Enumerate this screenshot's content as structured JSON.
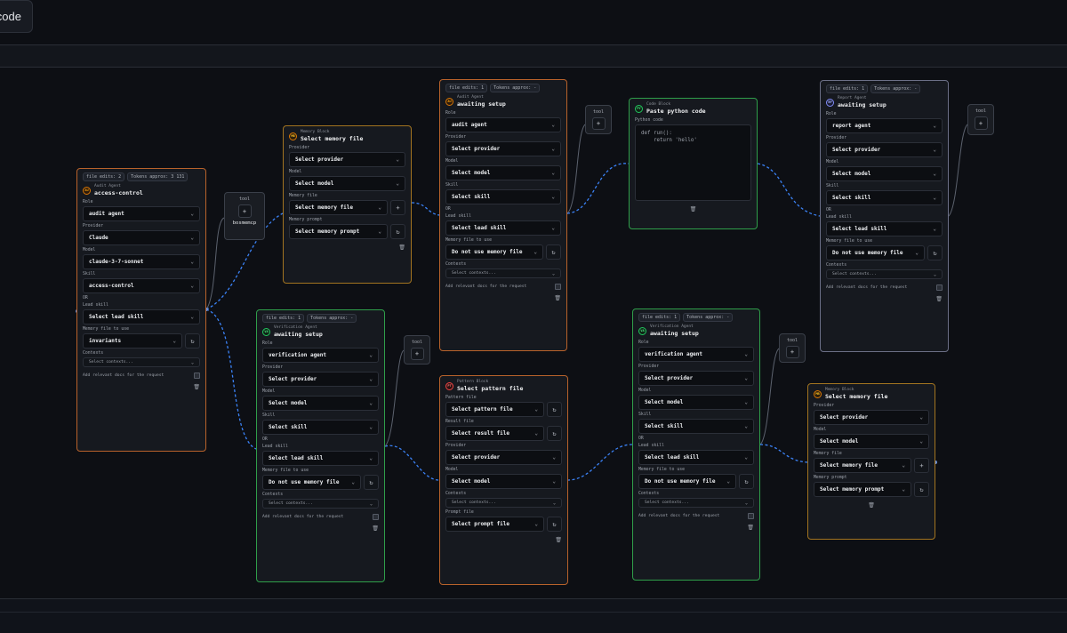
{
  "topbar": {
    "code_button_label": "code"
  },
  "tool_panels": [
    {
      "label": "tool",
      "add_icon": "plus-icon",
      "item": "bosmemcp"
    },
    {
      "label": "tool",
      "add_icon": "plus-icon"
    },
    {
      "label": "tool",
      "add_icon": "plus-icon"
    },
    {
      "label": "tool",
      "add_icon": "plus-icon"
    },
    {
      "label": "tool",
      "add_icon": "plus-icon"
    }
  ],
  "nodes": {
    "audit1": {
      "chips": [
        "file edits: 2",
        "Tokens approx: 3 131"
      ],
      "kind": "Audit Agent",
      "title": "access-control",
      "badge": "AU",
      "role_label": "Role",
      "role": "audit agent",
      "provider_label": "Provider",
      "provider": "Claude",
      "model_label": "Model",
      "model": "claude-3-7-sonnet",
      "skill_label": "Skill",
      "skill": "access-control",
      "or_label": "OR",
      "lead_label": "Lead skill",
      "lead": "Select lead skill",
      "memory_label": "Memory file to use",
      "memory": "invariants",
      "contexts_label": "Contexts",
      "contexts": "Select contexts...",
      "note": "Add relevant docs for the request"
    },
    "memory1": {
      "kind": "Memory Block",
      "title": "Select memory file",
      "badge": "MB",
      "provider_label": "Provider",
      "provider": "Select provider",
      "model_label": "Model",
      "model": "Select model",
      "file_label": "Memory file",
      "file": "Select memory file",
      "prompt_label": "Memory prompt",
      "prompt": "Select memory prompt"
    },
    "verify1": {
      "chips": [
        "file edits: 1",
        "Tokens approx: -"
      ],
      "kind": "Verification Agent",
      "title": "awaiting setup",
      "badge": "VA",
      "role_label": "Role",
      "role": "verification agent",
      "provider_label": "Provider",
      "provider": "Select provider",
      "model_label": "Model",
      "model": "Select model",
      "skill_label": "Skill",
      "skill": "Select skill",
      "or_label": "OR",
      "lead_label": "Lead skill",
      "lead": "Select lead skill",
      "memory_label": "Memory file to use",
      "memory": "Do not use memory file",
      "contexts_label": "Contexts",
      "contexts": "Select contexts...",
      "note": "Add relevant docs for the request"
    },
    "audit2": {
      "chips": [
        "file edits: 1",
        "Tokens approx: -"
      ],
      "kind": "Audit Agent",
      "title": "awaiting setup",
      "badge": "AU",
      "role_label": "Role",
      "role": "audit agent",
      "provider_label": "Provider",
      "provider": "Select provider",
      "model_label": "Model",
      "model": "Select model",
      "skill_label": "Skill",
      "skill": "Select skill",
      "or_label": "OR",
      "lead_label": "Lead skill",
      "lead": "Select lead skill",
      "memory_label": "Memory file to use",
      "memory": "Do not use memory file",
      "contexts_label": "Contexts",
      "contexts": "Select contexts...",
      "note": "Add relevant docs for the request"
    },
    "pattern1": {
      "kind": "Pattern Block",
      "title": "Select pattern file",
      "badge": "PT",
      "pattern_label": "Pattern file",
      "pattern": "Select pattern file",
      "result_label": "Result file",
      "result": "Select result file",
      "provider_label": "Provider",
      "provider": "Select provider",
      "model_label": "Model",
      "model": "Select model",
      "contexts_label": "Contexts",
      "contexts": "Select contexts...",
      "prompt_label": "Prompt file",
      "prompt": "Select prompt file"
    },
    "code1": {
      "kind": "Code Block",
      "title": "Paste python code",
      "badge": "PY",
      "code_label": "Python code",
      "code": "def run():\n    return 'hello'"
    },
    "verify2": {
      "chips": [
        "file edits: 1",
        "Tokens approx: -"
      ],
      "kind": "Verification Agent",
      "title": "awaiting setup",
      "badge": "VA",
      "role_label": "Role",
      "role": "verification agent",
      "provider_label": "Provider",
      "provider": "Select provider",
      "model_label": "Model",
      "model": "Select model",
      "skill_label": "Skill",
      "skill": "Select skill",
      "or_label": "OR",
      "lead_label": "Lead skill",
      "lead": "Select lead skill",
      "memory_label": "Memory file to use",
      "memory": "Do not use memory file",
      "contexts_label": "Contexts",
      "contexts": "Select contexts...",
      "note": "Add relevant docs for the request"
    },
    "report1": {
      "chips": [
        "file edits: 1",
        "Tokens approx: -"
      ],
      "kind": "Report Agent",
      "title": "awaiting setup",
      "badge": "RP",
      "role_label": "Role",
      "role": "report agent",
      "provider_label": "Provider",
      "provider": "Select provider",
      "model_label": "Model",
      "model": "Select model",
      "skill_label": "Skill",
      "skill": "Select skill",
      "or_label": "OR",
      "lead_label": "Lead skill",
      "lead": "Select lead skill",
      "memory_label": "Memory file to use",
      "memory": "Do not use memory file",
      "contexts_label": "Contexts",
      "contexts": "Select contexts...",
      "note": "Add relevant docs for the request"
    },
    "memory2": {
      "kind": "Memory Block",
      "title": "Select memory file",
      "badge": "MB",
      "provider_label": "Provider",
      "provider": "Select provider",
      "model_label": "Model",
      "model": "Select model",
      "file_label": "Memory file",
      "file": "Select memory file",
      "prompt_label": "Memory prompt",
      "prompt": "Select memory prompt"
    }
  },
  "icons": {
    "chevron": "chevron-down-icon",
    "refresh": "refresh-icon",
    "add": "plus-icon",
    "delete": "trash-icon"
  },
  "colors": {
    "background": "#0d0f14",
    "wire": "#3b82f6",
    "agent_audit_border": "#b8622b",
    "agent_verify_border": "#2f9e4a",
    "agent_report_border": "#6b6f86",
    "block_memory_border": "#a27420"
  }
}
